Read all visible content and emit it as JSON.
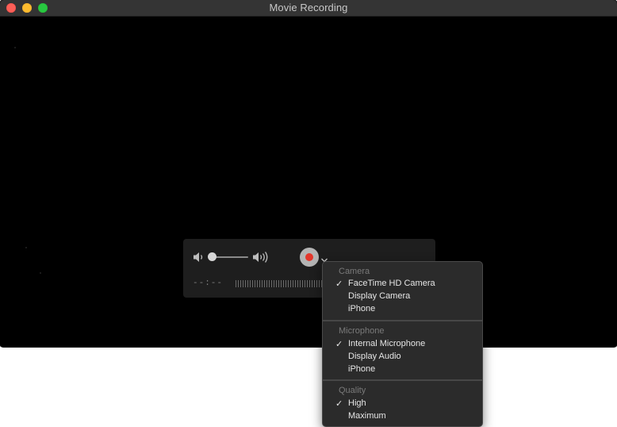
{
  "window": {
    "title": "Movie Recording"
  },
  "controls": {
    "volume_level": 0.0,
    "timecode": "--:--",
    "volume_low_icon": "speaker-low-icon",
    "volume_high_icon": "speaker-high-icon",
    "record_icon": "record-icon",
    "options_icon": "chevron-down-icon"
  },
  "menu": {
    "sections": [
      {
        "header": "Camera",
        "items": [
          {
            "label": "FaceTime HD Camera",
            "checked": true
          },
          {
            "label": "Display Camera",
            "checked": false
          },
          {
            "label": "iPhone",
            "checked": false
          }
        ]
      },
      {
        "header": "Microphone",
        "items": [
          {
            "label": "Internal Microphone",
            "checked": true
          },
          {
            "label": "Display Audio",
            "checked": false
          },
          {
            "label": "iPhone",
            "checked": false
          }
        ]
      },
      {
        "header": "Quality",
        "items": [
          {
            "label": "High",
            "checked": true
          },
          {
            "label": "Maximum",
            "checked": false
          }
        ]
      }
    ],
    "check_glyph": "✓"
  },
  "colors": {
    "record_red": "#e3362b",
    "close": "#fc5f57",
    "minimize": "#fdbc2e",
    "zoom": "#28c840"
  }
}
